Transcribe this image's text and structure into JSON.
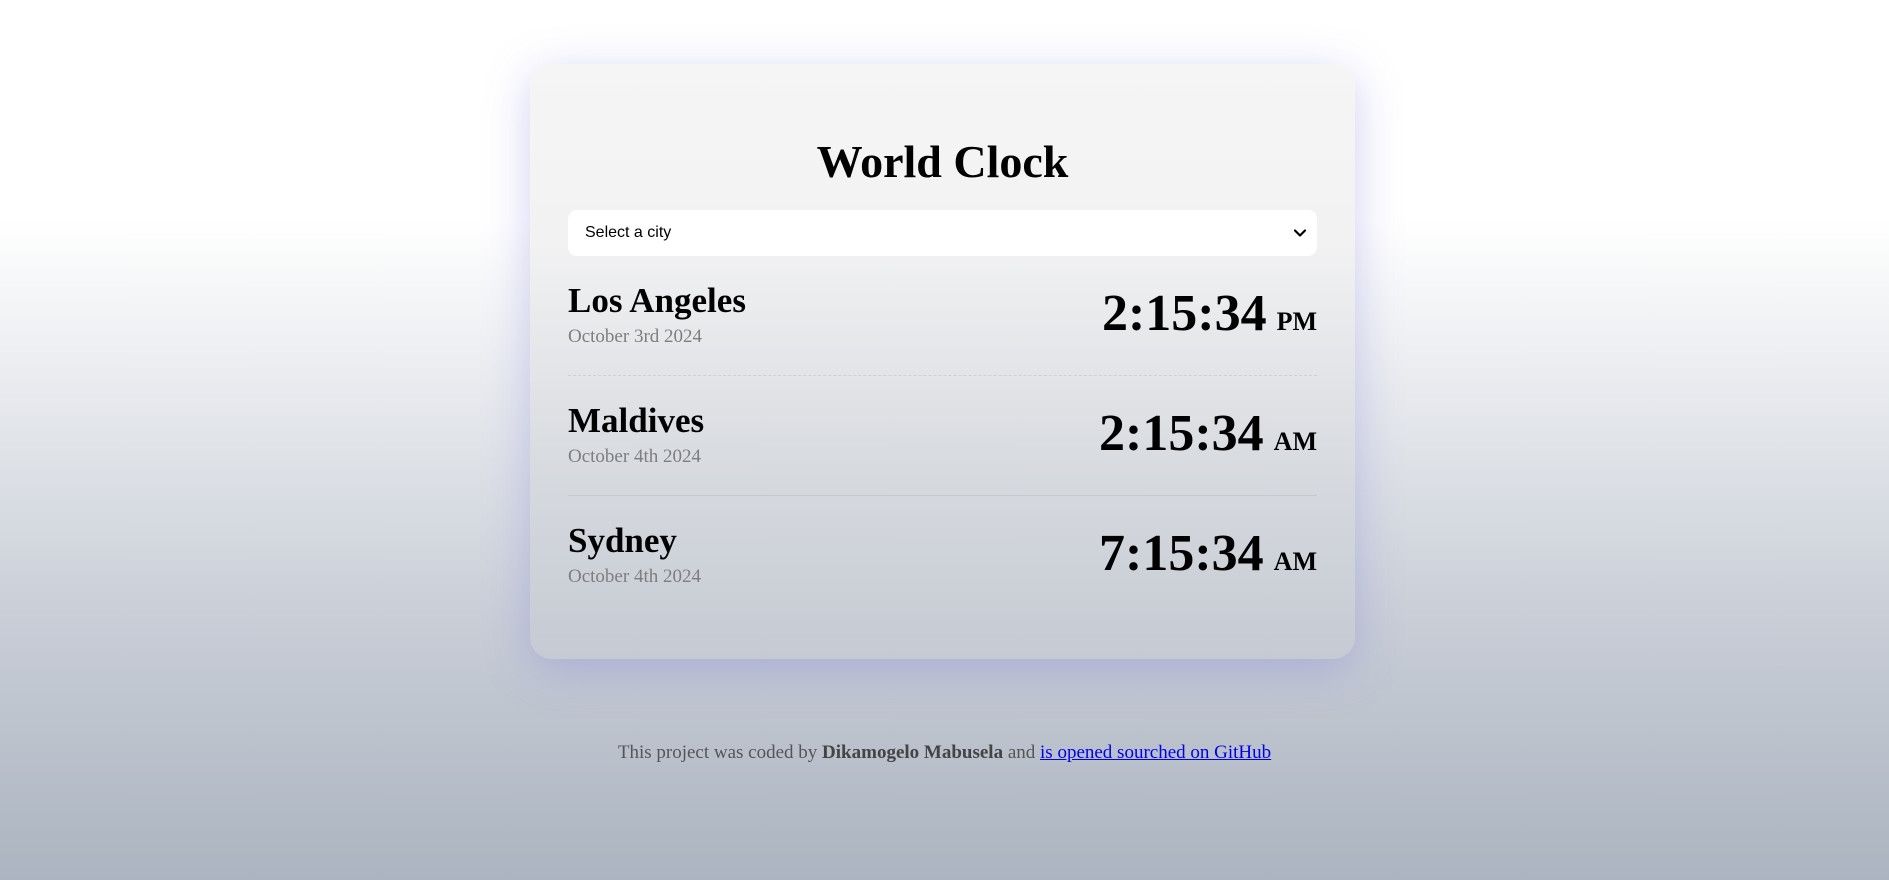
{
  "app": {
    "title": "World Clock"
  },
  "city_select": {
    "selected": "Select a city"
  },
  "cities": [
    {
      "name": "Los Angeles",
      "date": "October 3rd 2024",
      "time": "2:15:34",
      "ampm": "PM"
    },
    {
      "name": "Maldives",
      "date": "October 4th 2024",
      "time": "2:15:34",
      "ampm": "AM"
    },
    {
      "name": "Sydney",
      "date": "October 4th 2024",
      "time": "7:15:34",
      "ampm": "AM"
    }
  ],
  "footer": {
    "prefix": "This project was coded by",
    "author": "Dikamogelo Mabusela",
    "joiner": "and",
    "link_text": "is opened sourched on GitHub"
  },
  "icons": {
    "select_arrow": "chevron-down-icon"
  },
  "colors": {
    "link": "#0000ee",
    "date_text": "#7e7e7e"
  }
}
